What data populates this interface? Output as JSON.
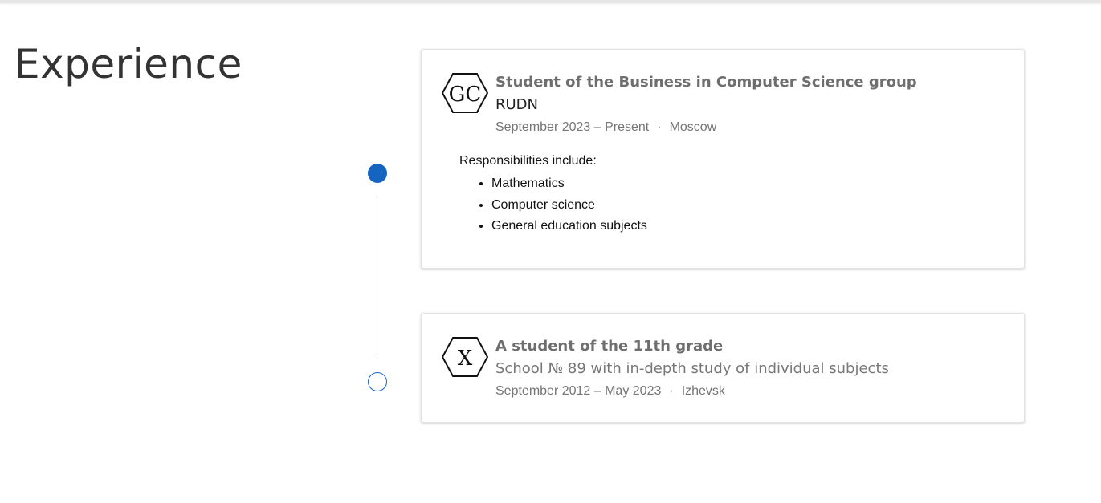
{
  "section": {
    "title": "Experience"
  },
  "entries": [
    {
      "logo_text": "GC",
      "title": "Student of the Business in Computer Science group",
      "org": "RUDN",
      "dates": "September 2023 – Present",
      "separator": "·",
      "location": "Moscow",
      "description": {
        "intro": "Responsibilities include:",
        "items": [
          "Mathematics",
          "Computer science",
          "General education subjects"
        ]
      },
      "marker": "filled"
    },
    {
      "logo_text": "X",
      "title": "A student of the 11th grade",
      "org": "School № 89 with in-depth study of individual subjects",
      "dates": "September 2012 – May 2023",
      "separator": "·",
      "location": "Izhevsk",
      "marker": "hollow"
    }
  ],
  "colors": {
    "accent": "#1565c0",
    "title_gray": "#6e6e6e",
    "meta_gray": "#757575"
  },
  "icons": {
    "entry_logo": "hexagon-logo-icon",
    "timeline_marker_filled": "filled-circle-icon",
    "timeline_marker_hollow": "hollow-circle-icon"
  }
}
